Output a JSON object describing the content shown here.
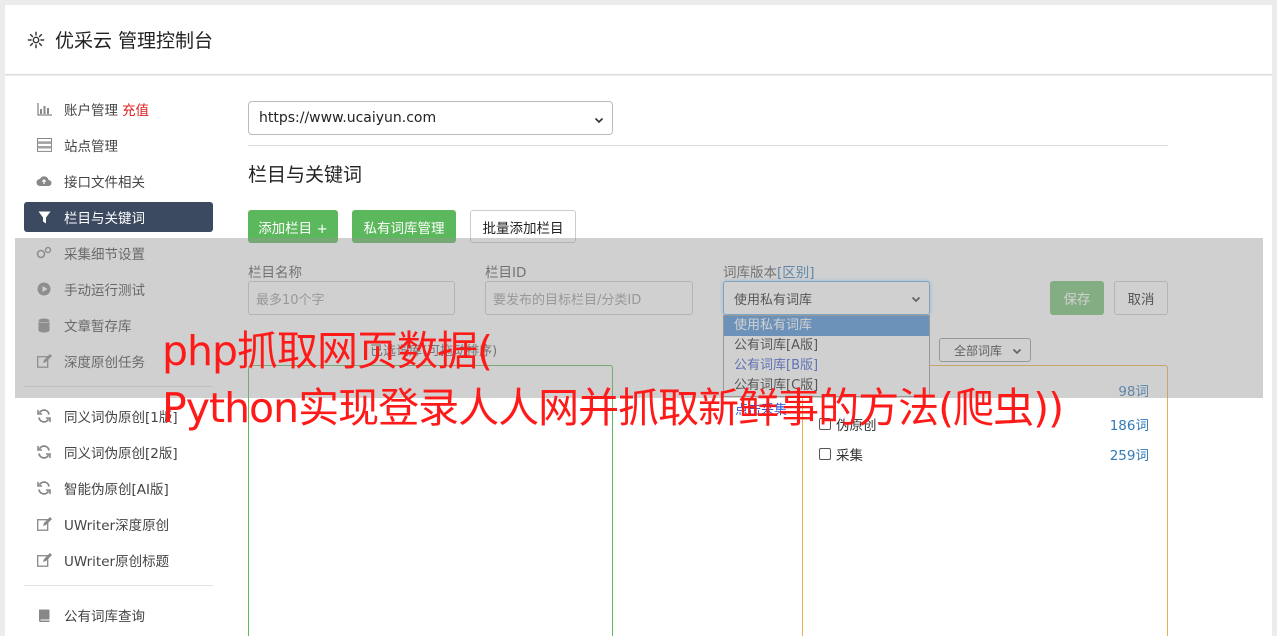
{
  "header": {
    "title": "优采云 管理控制台",
    "icon": "gear-icon"
  },
  "sidebar": {
    "group1": [
      {
        "label": "账户管理",
        "badge": "充值",
        "icon": "bar-chart-icon"
      },
      {
        "label": "站点管理",
        "icon": "server-icon"
      },
      {
        "label": "接口文件相关",
        "icon": "cloud-upload-icon"
      },
      {
        "label": "栏目与关键词",
        "icon": "filter-icon",
        "active": true
      },
      {
        "label": "采集细节设置",
        "icon": "gears-icon"
      },
      {
        "label": "手动运行测试",
        "icon": "play-icon"
      },
      {
        "label": "文章暂存库",
        "icon": "database-icon"
      },
      {
        "label": "深度原创任务",
        "icon": "edit-icon"
      }
    ],
    "group2": [
      {
        "label": "同义词伪原创[1版]",
        "icon": "refresh-icon"
      },
      {
        "label": "同义词伪原创[2版]",
        "icon": "refresh-icon"
      },
      {
        "label": "智能伪原创[AI版]",
        "icon": "refresh-icon"
      },
      {
        "label": "UWriter深度原创",
        "icon": "edit-icon"
      },
      {
        "label": "UWriter原创标题",
        "icon": "edit-icon"
      }
    ],
    "group3": [
      {
        "label": "公有词库查询",
        "icon": "book-icon"
      }
    ]
  },
  "main": {
    "site_select": "https://www.ucaiyun.com",
    "section_title": "栏目与关键词",
    "buttons": {
      "add_column": "添加栏目 +",
      "private_lib": "私有词库管理",
      "batch_add": "批量添加栏目",
      "save": "保存",
      "cancel": "取消"
    },
    "form": {
      "name_label": "栏目名称",
      "name_placeholder": "最多10个字",
      "id_label": "栏目ID",
      "id_placeholder": "要发布的目标栏目/分类ID",
      "version_label": "词库版本",
      "version_link": "[区别]",
      "version_value": "使用私有词库",
      "version_options": [
        "使用私有词库",
        "公有词库[A版]",
        "公有词库[B版]",
        "公有词库[C版]"
      ]
    },
    "left_box_title": "已选词库(可拖动排序)",
    "all_select": "全部词库",
    "libraries": [
      {
        "name": "",
        "count": "98词"
      },
      {
        "name": "伪原创",
        "count": "186词"
      },
      {
        "name": "采集",
        "count": "259词"
      }
    ],
    "hint_link": "点击采集"
  },
  "watermark": {
    "line1": "php抓取网页数据(",
    "line2": "Python实现登录人人网并抓取新鲜事的方法(爬虫))",
    "color": "#ff1a1a"
  }
}
